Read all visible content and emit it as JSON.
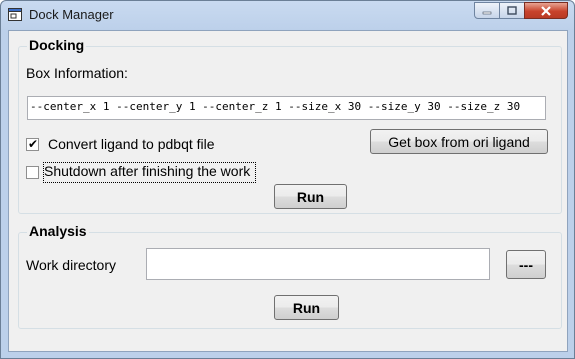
{
  "window": {
    "title": "Dock Manager",
    "minimize_label": "minimize",
    "maximize_label": "maximize",
    "close_label": "close"
  },
  "docking": {
    "group_title": "Docking",
    "box_info_label": "Box Information:",
    "box_info_value": "--center_x 1 --center_y 1 --center_z 1 --size_x 30 --size_y 30 --size_z 30",
    "convert_label": "Convert ligand to pdbqt file",
    "convert_checked": true,
    "shutdown_label": "Shutdown after finishing the work",
    "shutdown_checked": false,
    "get_box_button": "Get box from ori ligand",
    "run_button": "Run"
  },
  "analysis": {
    "group_title": "Analysis",
    "work_dir_label": "Work directory",
    "work_dir_value": "",
    "browse_button": "---",
    "run_button": "Run"
  }
}
